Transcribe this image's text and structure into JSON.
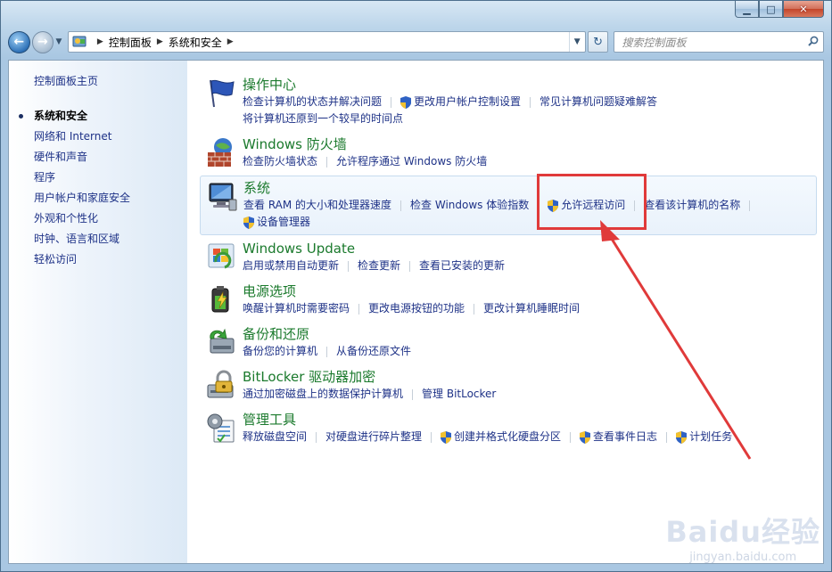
{
  "window": {
    "caption_min": "▁",
    "caption_max": "□",
    "caption_close": "✕"
  },
  "address": {
    "crumbs": [
      "控制面板",
      "系统和安全"
    ],
    "search_placeholder": "搜索控制面板"
  },
  "sidebar": {
    "home": "控制面板主页",
    "items": [
      {
        "label": "系统和安全",
        "current": true
      },
      {
        "label": "网络和 Internet"
      },
      {
        "label": "硬件和声音"
      },
      {
        "label": "程序"
      },
      {
        "label": "用户帐户和家庭安全"
      },
      {
        "label": "外观和个性化"
      },
      {
        "label": "时钟、语言和区域"
      },
      {
        "label": "轻松访问"
      }
    ]
  },
  "categories": [
    {
      "title": "操作中心",
      "links": [
        "检查计算机的状态并解决问题",
        "更改用户帐户控制设置",
        "常见计算机问题疑难解答",
        "将计算机还原到一个较早的时间点"
      ]
    },
    {
      "title": "Windows 防火墙",
      "links": [
        "检查防火墙状态",
        "允许程序通过 Windows 防火墙"
      ]
    },
    {
      "title": "系统",
      "links": [
        "查看 RAM 的大小和处理器速度",
        "检查 Windows 体验指数",
        "允许远程访问",
        "查看该计算机的名称",
        "设备管理器"
      ]
    },
    {
      "title": "Windows Update",
      "links": [
        "启用或禁用自动更新",
        "检查更新",
        "查看已安装的更新"
      ]
    },
    {
      "title": "电源选项",
      "links": [
        "唤醒计算机时需要密码",
        "更改电源按钮的功能",
        "更改计算机睡眠时间"
      ]
    },
    {
      "title": "备份和还原",
      "links": [
        "备份您的计算机",
        "从备份还原文件"
      ]
    },
    {
      "title": "BitLocker 驱动器加密",
      "links": [
        "通过加密磁盘上的数据保护计算机",
        "管理 BitLocker"
      ]
    },
    {
      "title": "管理工具",
      "links": [
        "释放磁盘空间",
        "对硬盘进行碎片整理",
        "创建并格式化硬盘分区",
        "查看事件日志",
        "计划任务"
      ]
    }
  ],
  "watermark": {
    "main": "Baidu经验",
    "sub": "jingyan.baidu.com"
  },
  "colors": {
    "link": "#1e3287",
    "category_title": "#1b7a2d",
    "highlight_box": "#e03a3a"
  },
  "icons": {
    "back": "back-arrow-icon",
    "forward": "forward-arrow-icon",
    "refresh": "refresh-icon",
    "search": "search-icon",
    "shield": "uac-shield-icon"
  }
}
